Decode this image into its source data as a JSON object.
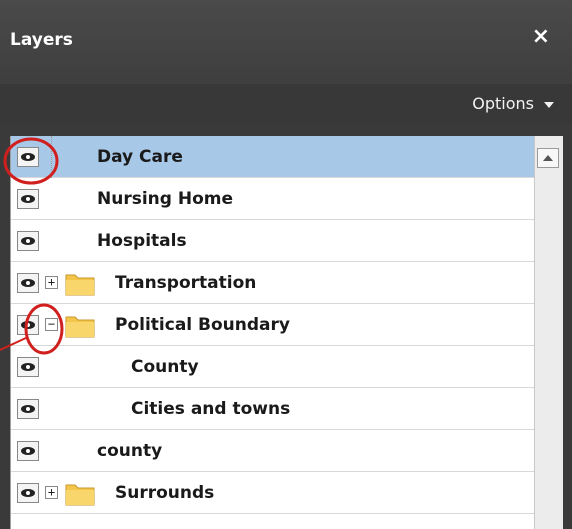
{
  "panel": {
    "title": "Layers",
    "close_symbol": "×",
    "options_label": "Options"
  },
  "layers": [
    {
      "label": "Day Care",
      "selected": true
    },
    {
      "label": "Nursing Home"
    },
    {
      "label": "Hospitals"
    },
    {
      "label": "Transportation",
      "group": true,
      "expander": "+"
    },
    {
      "label": "Political Boundary",
      "group": true,
      "expander": "−"
    },
    {
      "label": "County",
      "child": true
    },
    {
      "label": "Cities and towns",
      "child": true
    },
    {
      "label": "county"
    },
    {
      "label": "Surrounds",
      "group": true,
      "expander": "+"
    }
  ],
  "icons": {
    "visibility": "eye-icon",
    "folder": "folder-icon",
    "close": "close-icon",
    "options_caret": "caret-down-icon"
  },
  "colors": {
    "panel_bg": "#3a3a3a",
    "selected_row": "#a8c8e8",
    "annotation_circle": "#d0201e"
  }
}
